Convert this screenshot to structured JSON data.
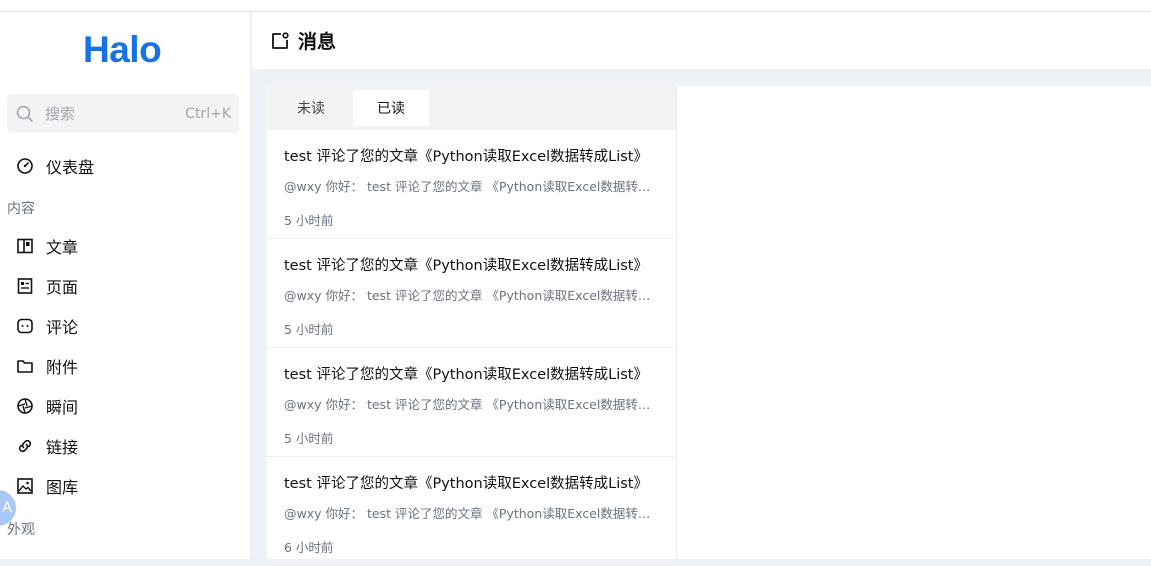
{
  "app": {
    "logo": "Halo"
  },
  "search": {
    "placeholder": "搜索",
    "shortcut": "Ctrl+K"
  },
  "sidebar": {
    "dashboard": "仪表盘",
    "groups": [
      {
        "label": "内容",
        "items": [
          "文章",
          "页面",
          "评论",
          "附件",
          "瞬间",
          "链接",
          "图库"
        ]
      },
      {
        "label": "外观"
      }
    ],
    "avatar_letter": "A"
  },
  "header": {
    "title": "消息"
  },
  "tabs": [
    {
      "label": "未读"
    },
    {
      "label": "已读",
      "active": true
    }
  ],
  "messages": [
    {
      "title": "test 评论了您的文章《Python读取Excel数据转成List》",
      "content": "@wxy 你好： test 评论了您的文章 《Python读取Excel数据转成List》",
      "time": "5 小时前"
    },
    {
      "title": "test 评论了您的文章《Python读取Excel数据转成List》",
      "content": "@wxy 你好： test 评论了您的文章 《Python读取Excel数据转成List》",
      "time": "5 小时前"
    },
    {
      "title": "test 评论了您的文章《Python读取Excel数据转成List》",
      "content": "@wxy 你好： test 评论了您的文章 《Python读取Excel数据转成List》",
      "time": "5 小时前"
    },
    {
      "title": "test 评论了您的文章《Python读取Excel数据转成List》",
      "content": "@wxy 你好： test 评论了您的文章 《Python读取Excel数据转成List》",
      "time": "6 小时前"
    }
  ],
  "colors": {
    "brand": "#1672e6",
    "muted": "#6b7280",
    "bg": "#eef2f6"
  }
}
